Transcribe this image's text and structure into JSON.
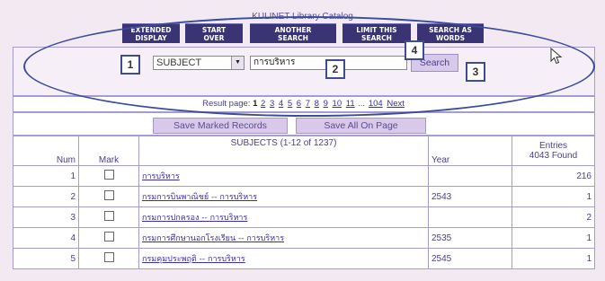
{
  "header": {
    "title": "KULINET Library Catalog",
    "nav": [
      {
        "label": "EXTENDED\nDISPLAY"
      },
      {
        "label": "START\nOVER"
      },
      {
        "label": "ANOTHER\nSEARCH"
      },
      {
        "label": "LIMIT THIS\nSEARCH"
      },
      {
        "label": "SEARCH AS\nWORDS"
      }
    ]
  },
  "search": {
    "field_selected": "SUBJECT",
    "query_value": "การบริหาร",
    "button_label": "Search"
  },
  "callouts": {
    "c1": "1",
    "c2": "2",
    "c3": "3",
    "c4": "4"
  },
  "results": {
    "prefix": "Result page:",
    "current_page": "1",
    "pages": [
      "2",
      "3",
      "4",
      "5",
      "6",
      "7",
      "8",
      "9",
      "10",
      "11"
    ],
    "ellipsis": "...",
    "last_page": "104",
    "next_label": "Next"
  },
  "actions": {
    "save_marked": "Save Marked Records",
    "save_all": "Save All On Page"
  },
  "table": {
    "headers": {
      "num": "Num",
      "mark": "Mark",
      "subjects": "SUBJECTS (1-12 of 1237)",
      "year": "Year",
      "entries_line1": "Entries",
      "entries_line2": "4043 Found"
    },
    "rows": [
      {
        "num": "1",
        "subject": "การบริหาร",
        "year": "",
        "entries": "216"
      },
      {
        "num": "2",
        "subject": "กรมการบินพาณิชย์ -- การบริหาร",
        "year": "2543",
        "entries": "1"
      },
      {
        "num": "3",
        "subject": "กรมการปกครอง -- การบริหาร",
        "year": "",
        "entries": "2"
      },
      {
        "num": "4",
        "subject": "กรมการศึกษานอกโรงเรียน -- การบริหาร",
        "year": "2535",
        "entries": "1"
      },
      {
        "num": "5",
        "subject": "กรมคุมประพฤติ -- การบริหาร",
        "year": "2545",
        "entries": "1"
      }
    ]
  }
}
